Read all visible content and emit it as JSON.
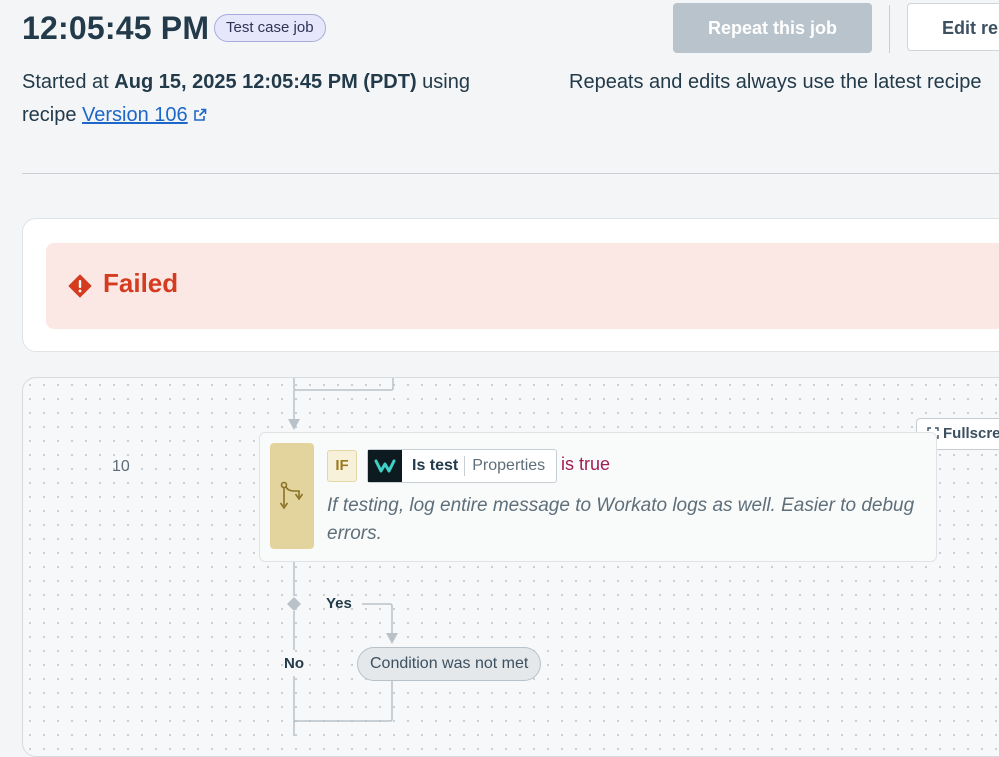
{
  "header": {
    "time": "12:05:45 PM",
    "badge": "Test case job",
    "repeat_button": "Repeat this job",
    "edit_button": "Edit re",
    "started_prefix": "Started at ",
    "started_datetime": "Aug 15, 2025 12:05:45 PM (PDT)",
    "started_suffix": " using recipe ",
    "version_link": "Version 106",
    "note": "Repeats and edits always use the latest recipe"
  },
  "status": {
    "label": "Failed",
    "color": "#d43b1f"
  },
  "canvas": {
    "fullscreen_button": "Fullscre",
    "step": {
      "number": "10",
      "keyword": "IF",
      "datapill_name": "Is test",
      "datapill_type": "Properties",
      "operator": "is true",
      "description": "If testing, log entire message to Workato logs as well. Easier to debug errors.",
      "app_icon": "workato-logo-icon",
      "step_icon": "branch-icon"
    },
    "branch_yes": "Yes",
    "branch_no": "No",
    "condition_result": "Condition was not met"
  },
  "colors": {
    "accent_link": "#1d67c9",
    "failed_bg": "#fbe8e4",
    "if_block": "#e2d49c",
    "operator": "#a21d58"
  }
}
